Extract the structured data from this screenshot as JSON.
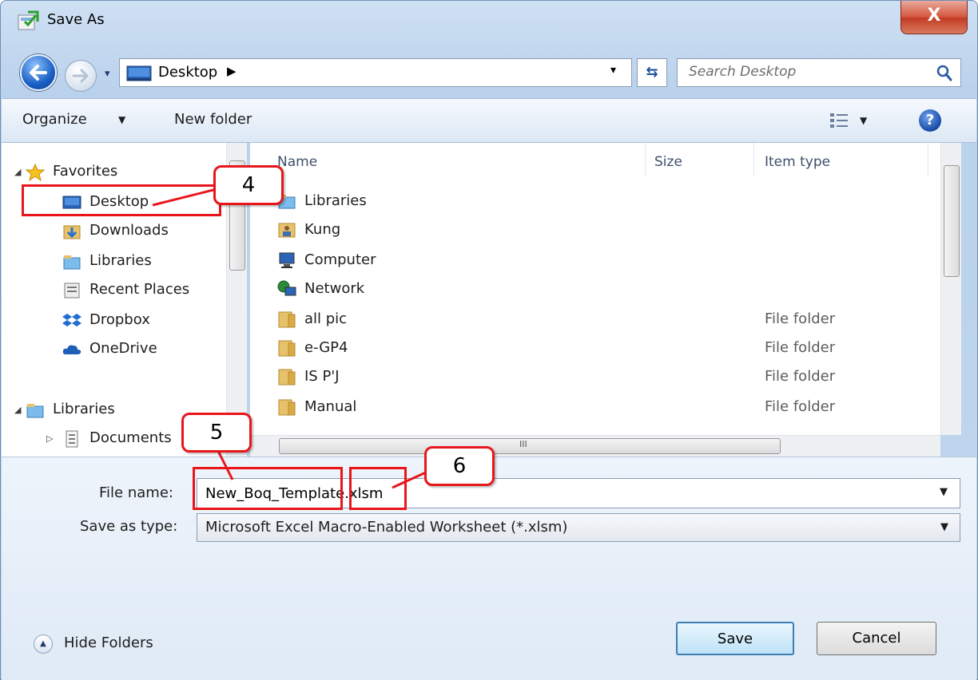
{
  "window": {
    "title": "Save As",
    "close_glyph": "X"
  },
  "address": {
    "location": "Desktop",
    "chevron": "▶",
    "dropdown_glyph": "▾",
    "refresh_glyph": "⇆",
    "search_placeholder": "Search Desktop"
  },
  "toolbar": {
    "organize_label": "Organize",
    "organize_arrow": "▼",
    "new_folder_label": "New folder",
    "view_arrow": "▼",
    "help_glyph": "?"
  },
  "nav": {
    "expand_open": "◢",
    "expand_closed": "▷",
    "favorites": "Favorites",
    "favorites_items": [
      "Desktop",
      "Downloads",
      "Libraries",
      "Recent Places",
      "Dropbox",
      "OneDrive"
    ],
    "libraries": "Libraries",
    "libraries_items": [
      "Documents"
    ]
  },
  "filelist": {
    "columns": [
      "Name",
      "Size",
      "Item type"
    ],
    "rows": [
      {
        "name": "Libraries",
        "type": ""
      },
      {
        "name": "Kung",
        "type": ""
      },
      {
        "name": "Computer",
        "type": ""
      },
      {
        "name": "Network",
        "type": ""
      },
      {
        "name": "all pic",
        "type": "File folder"
      },
      {
        "name": "e-GP4",
        "type": "File folder"
      },
      {
        "name": "IS P'J",
        "type": "File folder"
      },
      {
        "name": "Manual",
        "type": "File folder"
      }
    ],
    "hscroll_grip": "III"
  },
  "form": {
    "file_name_label": "File name:",
    "file_name_value": "New_Boq_Template.xlsm",
    "file_name_arrow": "▼",
    "save_type_label": "Save as type:",
    "save_type_value": "Microsoft Excel Macro-Enabled Worksheet (*.xlsm)",
    "save_type_arrow": "▼",
    "hide_folders_label": "Hide Folders",
    "hide_folders_glyph": "▲",
    "save_button": "Save",
    "cancel_button": "Cancel"
  },
  "annotations": {
    "step4": "4",
    "step5": "5",
    "step6": "6",
    "color": "#e8161b"
  },
  "colors": {
    "accent": "#1a5fc4",
    "selection": "#cde8ff",
    "annotation": "#e8161b"
  }
}
